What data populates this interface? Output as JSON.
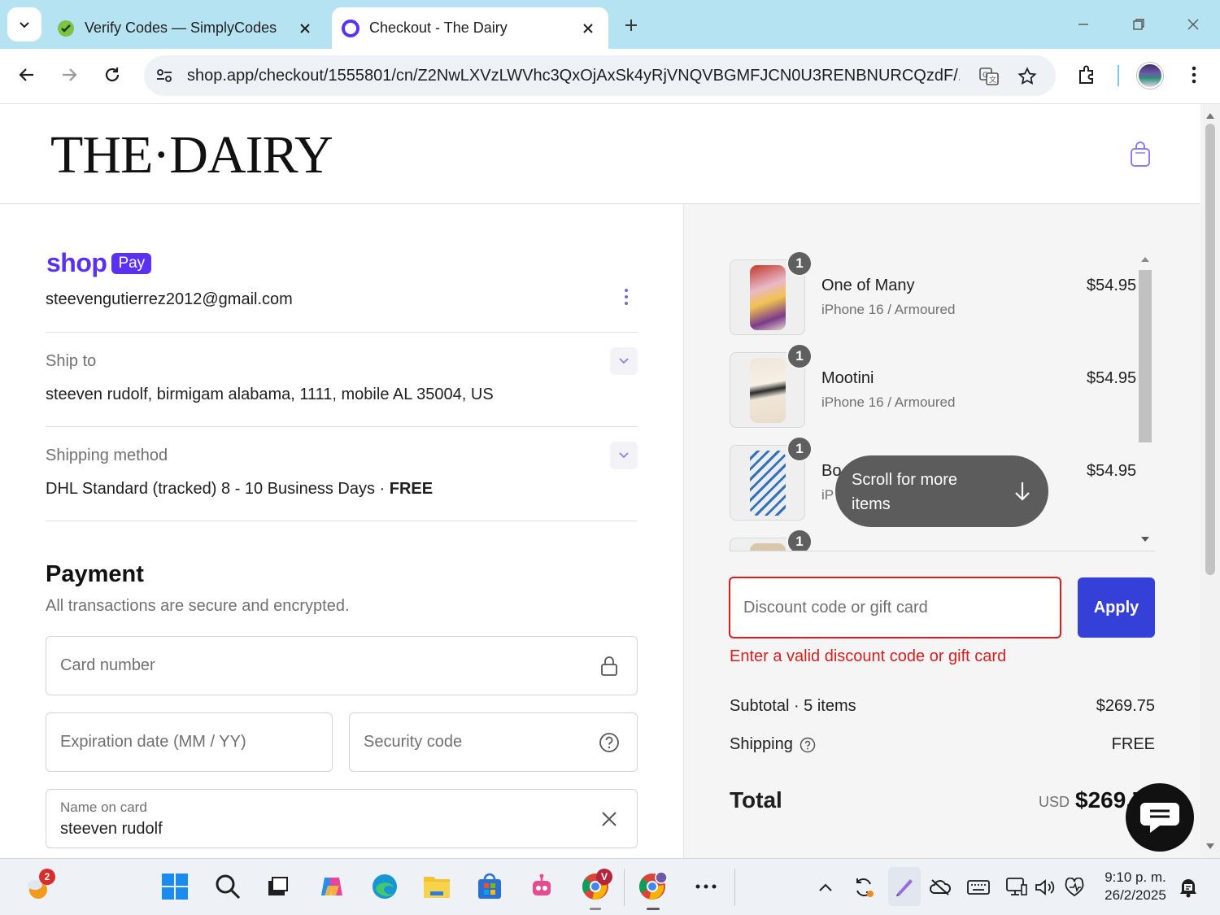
{
  "browser": {
    "tabs": [
      {
        "title": "Verify Codes — SimplyCodes",
        "active": false
      },
      {
        "title": "Checkout - The Dairy",
        "active": true
      }
    ],
    "url": "shop.app/checkout/1555801/cn/Z2NwLXVzLWVhc3QxOjAxSk4yRjVNQVBGMFJCN0U3RENBNURCQzdF/..."
  },
  "header": {
    "logo": "THE·DAIRY"
  },
  "shop_pay": {
    "word": "shop",
    "pill": "Pay",
    "email": "steevengutierrez2012@gmail.com"
  },
  "ship_to": {
    "label": "Ship to",
    "value": "steeven rudolf, birmigam alabama, 1111, mobile AL 35004, US"
  },
  "shipping_method": {
    "label": "Shipping method",
    "value": "DHL Standard (tracked) 8 - 10 Business Days · ",
    "value_bold": "FREE"
  },
  "payment": {
    "title": "Payment",
    "subtitle": "All transactions are secure and encrypted.",
    "card_number_placeholder": "Card number",
    "expiration_placeholder": "Expiration date (MM / YY)",
    "security_placeholder": "Security code",
    "name_label": "Name on card",
    "name_value": "steeven rudolf"
  },
  "cart": {
    "items": [
      {
        "qty": "1",
        "name": "One of Many",
        "variant": "iPhone 16 / Armoured",
        "price": "$54.95"
      },
      {
        "qty": "1",
        "name": "Mootini",
        "variant": "iPhone 16 / Armoured",
        "price": "$54.95"
      },
      {
        "qty": "1",
        "name": "Bo",
        "variant": "iP",
        "price": "$54.95"
      },
      {
        "qty": "1"
      }
    ],
    "scroll_hint": "Scroll for more items"
  },
  "discount": {
    "placeholder": "Discount code or gift card",
    "apply_label": "Apply",
    "error": "Enter a valid discount code or gift card"
  },
  "summary": {
    "subtotal_label": "Subtotal · 5 items",
    "subtotal_value": "$269.75",
    "shipping_label": "Shipping",
    "shipping_value": "FREE",
    "total_label": "Total",
    "currency": "USD",
    "total_value": "$269.75"
  },
  "taskbar": {
    "weather_badge": "2",
    "chrome_badge": "V",
    "time": "9:10 p. m.",
    "date": "26/2/2025"
  },
  "colors": {
    "shop_pay_purple": "#5a31f4",
    "apply_blue": "#3440d8",
    "error_red": "#dd1d1d",
    "tabstrip": "#b5e3f2"
  }
}
